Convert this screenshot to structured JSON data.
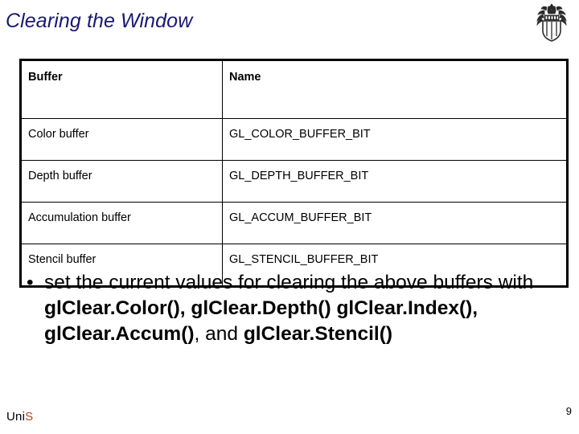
{
  "slide": {
    "title": "Clearing the Window",
    "title_color": "#191970",
    "page_number": "9"
  },
  "logo": {
    "crest_icon": "university-crest-icon"
  },
  "table": {
    "columns": [
      "Buffer",
      "Name"
    ],
    "rows": [
      [
        "Color buffer",
        "GL_COLOR_BUFFER_BIT"
      ],
      [
        "Depth buffer",
        "GL_DEPTH_BUFFER_BIT"
      ],
      [
        "Accumulation buffer",
        "GL_ACCUM_BUFFER_BIT"
      ],
      [
        "Stencil buffer",
        "GL_STENCIL_BUFFER_BIT"
      ]
    ]
  },
  "body": {
    "bullet_marker": "•",
    "bullet": {
      "segments": [
        {
          "text": "set the current values for clearing the above buffers with ",
          "bold": false
        },
        {
          "text": "glClear.Color(), glClear.Depth() glClear.Index(), glClear.Accum()",
          "bold": true
        },
        {
          "text": ", and ",
          "bold": false
        },
        {
          "text": "glClear.Stencil()",
          "bold": true
        }
      ]
    }
  },
  "footer": {
    "logo_primary": "Uni",
    "logo_accent": "S",
    "accent_color": "#b5431f"
  }
}
